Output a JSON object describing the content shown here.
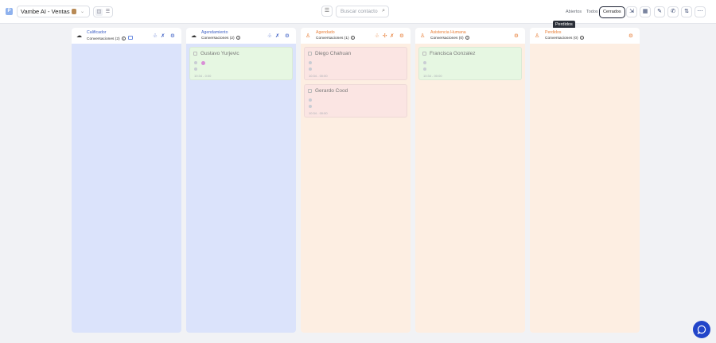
{
  "app": {
    "logo_letter": "P",
    "project_name": "Vambe AI - Ventas"
  },
  "toolbar": {
    "search_placeholder": "Buscar contacto",
    "status_tabs": [
      "Abiertos",
      "Todos",
      "Cerrados"
    ],
    "active_status": "Cerrados",
    "tooltip": "Perdidos"
  },
  "columns": [
    {
      "title": "Calificador",
      "subtitle": "Conversaciones (2)",
      "theme": "blue",
      "icon": "robot-icon",
      "cards": []
    },
    {
      "title": "Agendamiento",
      "subtitle": "Conversaciones (2)",
      "theme": "blue",
      "icon": "robot-icon",
      "cards": [
        {
          "name": "Gustavo Yurjevic",
          "time": "10:34 - 0:00",
          "color": "green"
        }
      ]
    },
    {
      "title": "Agendado",
      "subtitle": "Conversaciones (1)",
      "theme": "orange",
      "icon": "user-icon",
      "cards": [
        {
          "name": "Diego Chahuan",
          "time": "10:34 - 00:00",
          "color": "red"
        },
        {
          "name": "Gerardo Cood",
          "time": "10:34 - 00:00",
          "color": "red"
        }
      ]
    },
    {
      "title": "Asistencia Humana",
      "subtitle": "Conversaciones (0)",
      "theme": "orange",
      "icon": "user-icon",
      "cards": [
        {
          "name": "Francisca Gonzalez",
          "time": "10:34 - 00:00",
          "color": "green"
        }
      ]
    },
    {
      "title": "Perdidos",
      "subtitle": "Conversaciones (0)",
      "theme": "orange",
      "icon": "user-icon",
      "cards": []
    }
  ],
  "colors": {
    "blue_col": "#dbe3fb",
    "orange_col": "#fdeee2",
    "fab": "#2245c9"
  }
}
